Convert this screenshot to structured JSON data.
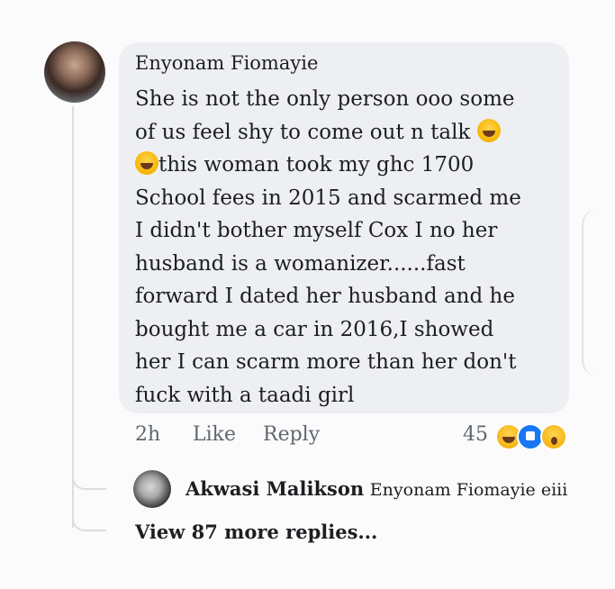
{
  "comment": {
    "author": "Enyonam Fiomayie",
    "line1": "She is not the only person ooo some",
    "line2_text": "of us feel shy to come out n talk ",
    "line3_text": "this woman took my ghc 1700",
    "line4": "School fees in 2015 and scarmed me",
    "line5": "I didn't bother myself Cox I no her",
    "line6": "husband is a womanizer......fast",
    "line7": "forward I dated her husband and he",
    "line8": "bought me a car in 2016,I showed",
    "line9": "her I can scarm more than her don't",
    "line10": "fuck with a taadi girl",
    "emoji": "rolling-on-floor-laughing-icon"
  },
  "actions": {
    "time": "2h",
    "like": "Like",
    "reply": "Reply",
    "reaction_count": "45",
    "reactions": [
      "haha-icon",
      "like-icon",
      "wow-icon"
    ]
  },
  "reply": {
    "author": "Akwasi Malikson",
    "text": "Enyonam Fiomayie eiii"
  },
  "view_more": "View 87 more replies..."
}
